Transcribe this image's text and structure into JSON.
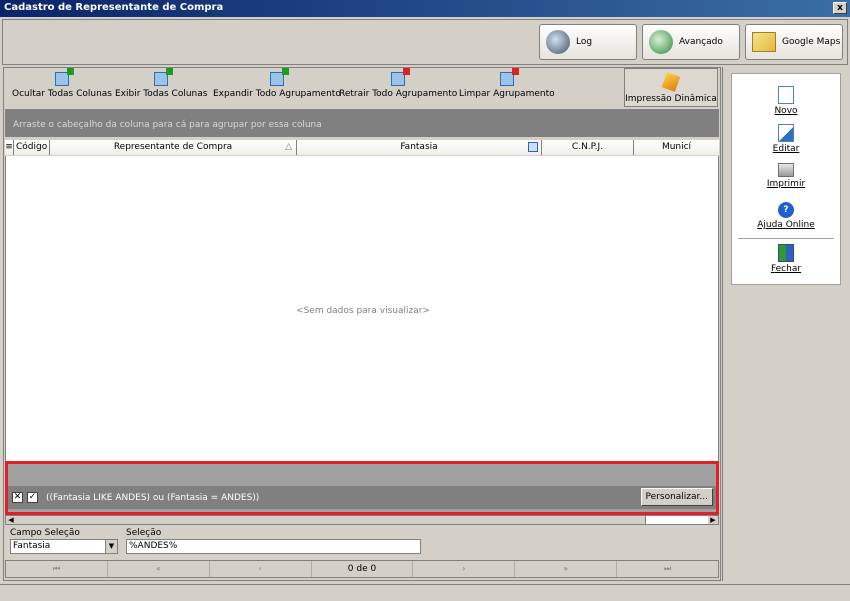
{
  "window": {
    "title": "Cadastro de Representante de Compra",
    "close_label": "x"
  },
  "topbar": {
    "log_label": "Log",
    "advanced_label": "Avançado",
    "maps_label": "Google Maps"
  },
  "toolbar": {
    "items": [
      {
        "label": "Ocultar Todas Colunas"
      },
      {
        "label": "Exibir Todas  Colunas"
      },
      {
        "label": "Expandir Todo Agrupamento"
      },
      {
        "label": "Retrair Todo Agrupamento"
      },
      {
        "label": "Limpar Agrupamento"
      }
    ],
    "dynamic_print_label": "Impressão Dinâmica"
  },
  "grid": {
    "group_hint": "Arraste o cabeçalho da coluna para cá para agrupar por essa coluna",
    "columns": [
      "Código",
      "Representante de Compra",
      "Fantasia",
      "C.N.P.J.",
      "Municí"
    ],
    "sort_indicator": "△",
    "empty_message": "<Sem dados para visualizar>"
  },
  "filter": {
    "clear_label": "✕",
    "enabled_label": "✓",
    "expression": "((Fantasia LIKE ANDES) ou (Fantasia = ANDES))",
    "customize_label": "Personalizar..."
  },
  "selection": {
    "field_label": "Campo Seleção",
    "field_value": "Fantasia",
    "value_label": "Seleção",
    "value": "%ANDES%"
  },
  "navigator": {
    "first": "⏮",
    "prev_page": "«",
    "prev": "‹",
    "count": "0 de 0",
    "next": "›",
    "next_page": "»",
    "last": "⏭"
  },
  "sidebar": {
    "new_label": "Novo",
    "edit_label": "Editar",
    "print_label": "Imprimir",
    "help_label": "Ajuda Online",
    "close_label": "Fechar"
  }
}
